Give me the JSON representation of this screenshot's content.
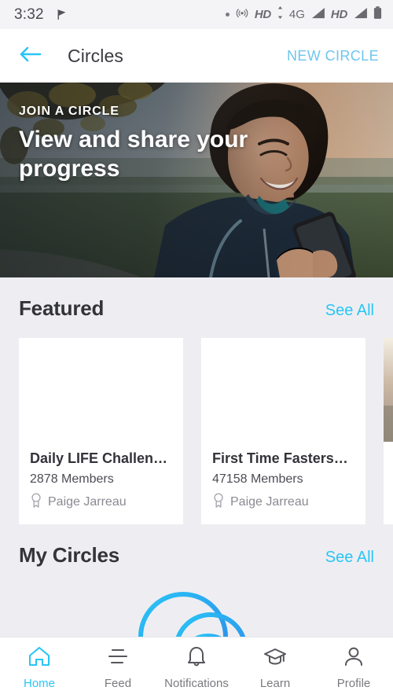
{
  "status_bar": {
    "time": "3:32",
    "left_icon": "flag-icon",
    "dot": "•",
    "hotspot_icon": "hotspot-icon",
    "hd_label_1": "HD",
    "data_arrows_icon": "data-transfer-icon",
    "network_label": "4G",
    "signal_icon_1": "signal-bars-icon",
    "hd_label_2": "HD",
    "signal_icon_2": "signal-bars-icon",
    "battery_icon": "battery-icon"
  },
  "app_bar": {
    "back_icon": "back-arrow-icon",
    "title": "Circles",
    "action_label": "NEW CIRCLE"
  },
  "hero": {
    "kicker": "JOIN A CIRCLE",
    "title": "View and share your progress"
  },
  "sections": [
    {
      "title": "Featured",
      "see_all_label": "See All"
    },
    {
      "title": "My Circles",
      "see_all_label": "See All"
    }
  ],
  "featured_cards": [
    {
      "title": "Daily LIFE Challen…",
      "members": "2878 Members",
      "author": "Paige Jarreau",
      "author_icon": "award-icon"
    },
    {
      "title": "First Time Fasters…",
      "members": "47158 Members",
      "author": "Paige Jarreau",
      "author_icon": "award-icon"
    },
    {
      "title": "",
      "members": "",
      "author": "",
      "author_icon": "award-icon"
    }
  ],
  "bottom_nav": [
    {
      "label": "Home",
      "icon": "home-icon",
      "active": true
    },
    {
      "label": "Feed",
      "icon": "feed-lines-icon",
      "active": false
    },
    {
      "label": "Notifications",
      "icon": "bell-icon",
      "active": false
    },
    {
      "label": "Learn",
      "icon": "graduation-cap-icon",
      "active": false
    },
    {
      "label": "Profile",
      "icon": "person-icon",
      "active": false
    }
  ],
  "colors": {
    "accent": "#29c5f6",
    "accent_soft": "#6fc5ee",
    "page_bg": "#eeeef2",
    "text_dark": "#33333a",
    "text_muted": "#8a8a92"
  }
}
